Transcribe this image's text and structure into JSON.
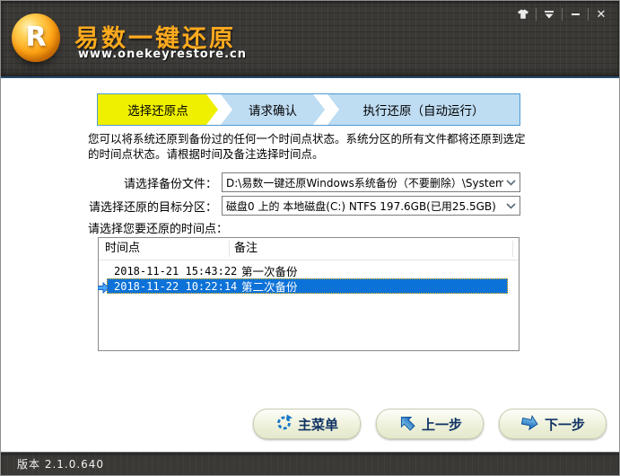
{
  "titlebar": {
    "brand": "易数一键还原",
    "website": "www.onekeyrestore.cn",
    "logo_letter": "R",
    "close_glyph": "✕"
  },
  "icons": {
    "skin-icon": "t-shirt (change skin)",
    "collapse-icon": "bar with down triangle",
    "minimize-icon": "horizontal bar",
    "close-icon": "✕",
    "combo-chevron": "∨",
    "row-marker": "blue right arrow",
    "main-menu-icon": "dashed circular arrow",
    "prev-icon": "glossy blue up-left arrow",
    "next-icon": "glossy blue right arrow"
  },
  "steps": [
    {
      "label": "选择还原点",
      "active": true
    },
    {
      "label": "请求确认",
      "active": false
    },
    {
      "label": "执行还原（自动运行）",
      "active": false
    }
  ],
  "description": "您可以将系统还原到备份过的任何一个时间点状态。系统分区的所有文件都将还原到选定的时间点状态。请根据时间及备注选择时间点。",
  "form": {
    "backup_file_label": "请选择备份文件：",
    "backup_file_value": "D:\\易数一键还原Windows系统备份（不要删除）\\SystemImag",
    "partition_label": "请选择还原的目标分区：",
    "partition_value": "磁盘0 上的 本地磁盘(C:) NTFS 197.6GB(已用25.5GB)"
  },
  "restore_points": {
    "section_label": "请选择您要还原的时间点：",
    "col_time": "时间点",
    "col_note": "备注",
    "rows": [
      {
        "time": "2018-11-21 15:43:22",
        "note": "第一次备份",
        "selected": false
      },
      {
        "time": "2018-11-22 10:22:14",
        "note": "第二次备份",
        "selected": true
      }
    ]
  },
  "buttons": {
    "main_menu": "主菜单",
    "prev": "上一步",
    "next": "下一步"
  },
  "footer": {
    "version": "版本 2.1.0.640"
  },
  "colors": {
    "titlebar_bg": "#3b3936",
    "brand_orange": "#ffaa1e",
    "active_tab_yellow": "#eef000",
    "inactive_tab_blue": "#bedcf2",
    "tab_border_blue": "#4f9bd6",
    "selection_blue": "#0d72d8",
    "focus_dotted_orange": "#ffb400",
    "button_text_navy": "#0f3264"
  }
}
